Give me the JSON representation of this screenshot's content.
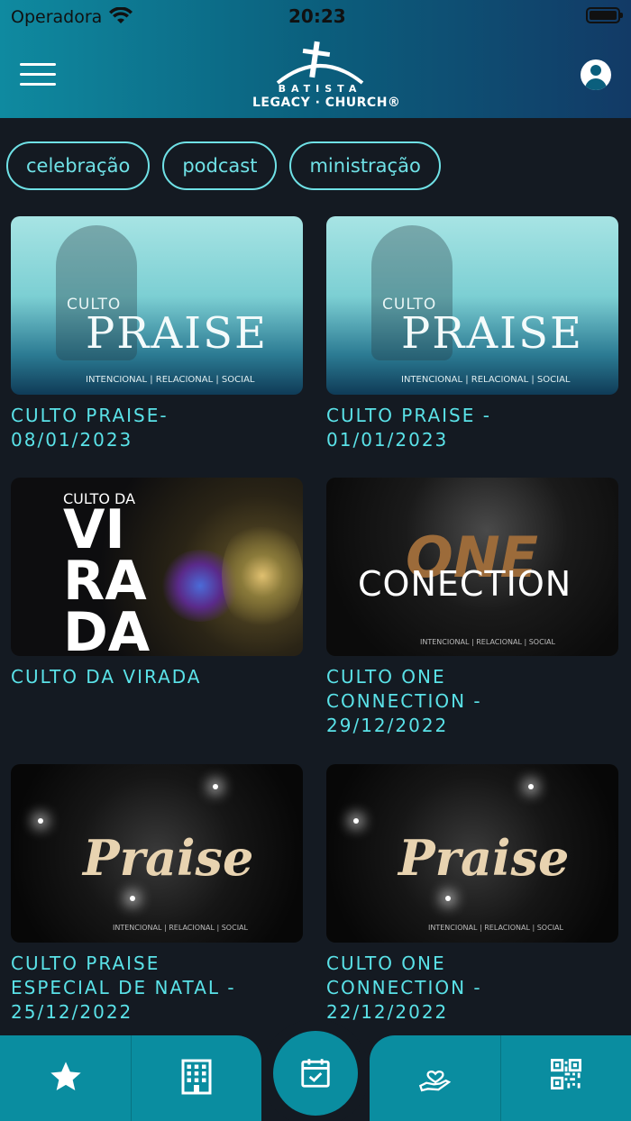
{
  "status_bar": {
    "carrier": "Operadora",
    "time": "20:23"
  },
  "header": {
    "logo_top": "BATISTA",
    "logo_main": "LEGACY · CHURCH®",
    "menu_icon": "hamburger-icon",
    "profile_icon": "user-circle-icon"
  },
  "chips": [
    {
      "label": "celebração"
    },
    {
      "label": "podcast"
    },
    {
      "label": "ministração"
    }
  ],
  "cards": [
    {
      "title": "CULTO PRAISE-\n08/01/2023",
      "thumb": {
        "small": "CULTO",
        "big": "PRAISE",
        "foot": "INTENCIONAL | RELACIONAL | SOCIAL"
      }
    },
    {
      "title": "CULTO PRAISE -\n01/01/2023",
      "thumb": {
        "small": "CULTO",
        "big": "PRAISE",
        "foot": "INTENCIONAL | RELACIONAL | SOCIAL"
      }
    },
    {
      "title": "CULTO DA VIRADA",
      "thumb": {
        "small": "CULTO DA",
        "big": "VI\nRA\nDA"
      }
    },
    {
      "title": "CULTO ONE\nCONNECTION -\n29/12/2022",
      "thumb": {
        "one": "ONE",
        "conection": "CONECTION",
        "foot": "INTENCIONAL | RELACIONAL | SOCIAL"
      }
    },
    {
      "title": "CULTO PRAISE\nESPECIAL DE NATAL -\n25/12/2022",
      "thumb": {
        "big": "Praise",
        "foot": "INTENCIONAL | RELACIONAL | SOCIAL"
      }
    },
    {
      "title": "CULTO ONE\nCONNECTION -\n22/12/2022",
      "thumb": {
        "big": "Praise",
        "foot": "INTENCIONAL | RELACIONAL | SOCIAL"
      }
    }
  ],
  "tabbar": {
    "items": [
      "star-icon",
      "building-icon",
      "calendar-check-icon",
      "heart-hand-icon",
      "qr-code-icon"
    ],
    "accent": "#0a8da0"
  },
  "colors": {
    "accent": "#5ae2e8",
    "background": "#141a22"
  }
}
